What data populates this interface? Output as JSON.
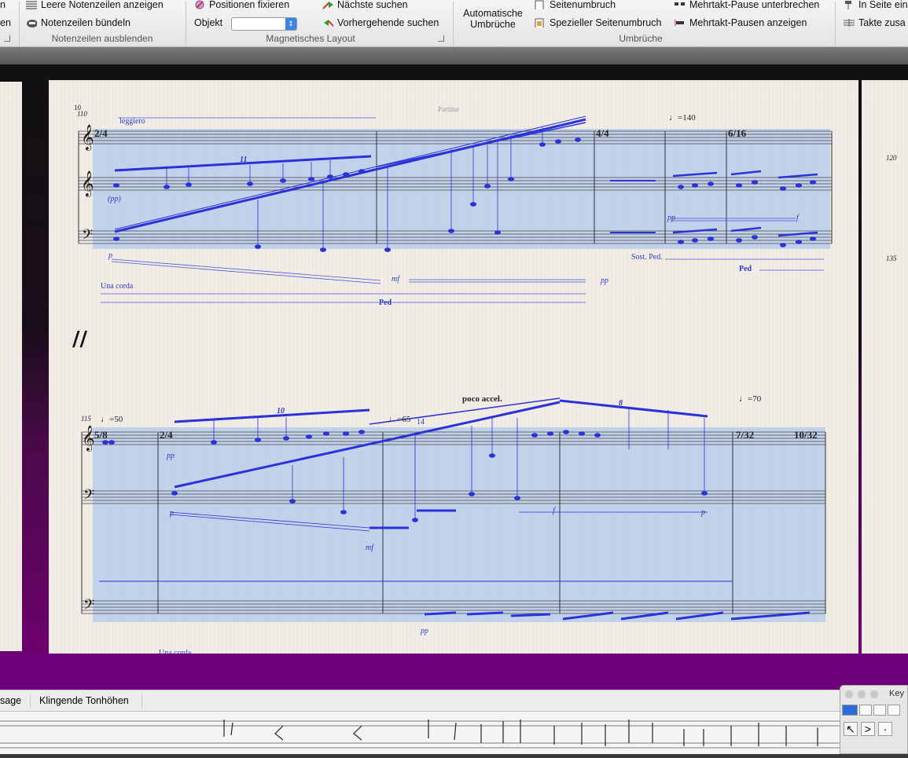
{
  "ribbon": {
    "group1": {
      "items": [
        "n",
        "en"
      ],
      "launcher": "⇲"
    },
    "hide_staves": {
      "show_empty": "Leere Notenzeilen anzeigen",
      "bundle": "Notenzeilen bündeln",
      "title": "Notenzeilen ausblenden"
    },
    "magnetic": {
      "fix_positions": "Positionen fixieren",
      "object_label": "Objekt",
      "object_value": "",
      "title": "Magnetisches Layout"
    },
    "find": {
      "next": "Nächste suchen",
      "previous": "Vorhergehende suchen"
    },
    "breaks": {
      "auto_breaks": "Automatische Umbrüche",
      "page_break": "Seitenumbruch",
      "special_page_break": "Spezieller Seitenumbruch",
      "break_multirest": "Mehrtakt-Pause unterbrechen",
      "show_multirest": "Mehrtakt-Pausen anzeigen",
      "title": "Umbrüche"
    },
    "format": {
      "in_page": "In Seite ein",
      "merge_bars": "Takte zusa"
    }
  },
  "score": {
    "header": "Partitur",
    "page_number": "10",
    "bar_110": "110",
    "bar_115": "115",
    "bar_120": "120",
    "bar_135": "135",
    "bar_14": "14",
    "tempo_1": "=140",
    "tempo_2": "=50",
    "tempo_3": "=65",
    "tempo_4": "=70",
    "leggiero": "leggiero",
    "pp_paren": "(pp)",
    "una_corda": "Una corda",
    "una_corda_2": "Una corda",
    "sost_ped": "Sost. Ped.",
    "poco_accel": "poco accel.",
    "tuplet_11": "11",
    "tuplet_10": "10",
    "tuplet_8": "8",
    "dyn_p": "p",
    "dyn_mf": "mf",
    "dyn_mf2": "mf",
    "dyn_pp1": "pp",
    "dyn_pp2": "pp",
    "dyn_pp3": "pp",
    "dyn_pp4": "pp",
    "dyn_f": "f",
    "dyn_f2": "f",
    "dyn_p2": "p",
    "dyn_p3": "p",
    "ped1": "Ped",
    "ped2": "Ped",
    "time_sigs": [
      "2/4",
      "4/4",
      "6/16",
      "5/8",
      "2/4",
      "7/32",
      "10/32"
    ]
  },
  "bottom": {
    "tabs": [
      "sage",
      "Klingende Tonhöhen"
    ],
    "keypad_title": "Key",
    "keypad_buttons": [
      "↖",
      ">",
      "·"
    ]
  },
  "colors": {
    "selection": "#9dbcef",
    "selection_note": "#2a32d8",
    "purple_bg": "#6e007a",
    "paper": "#f1ede6"
  }
}
